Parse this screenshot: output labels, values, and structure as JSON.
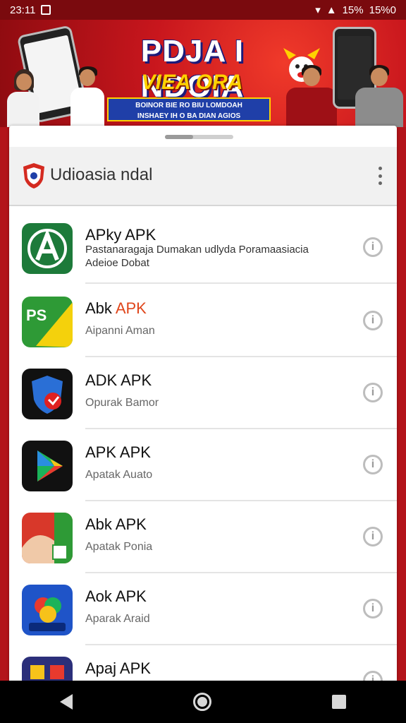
{
  "status_bar": {
    "time": "23:11",
    "battery_text": "15%",
    "extra_text": "15%0"
  },
  "banner": {
    "title": "PDJA I NDOIA",
    "subtitle": "VIEA ORA PAISIA",
    "tagline_line1": "BOINOR BIE RO BIU LOMDOAH",
    "tagline_line2": "INSHAEY IH O BA DIAN AGIOS"
  },
  "app_header": {
    "title": "Udioasia ndal"
  },
  "apps": [
    {
      "title": "APky APK",
      "title_accent": "",
      "subtitle": "Pastanaragaja Dumakan udlyda Poramaasiacia Adeioe Dobat",
      "icon": "a-logo-icon"
    },
    {
      "title": "Abk ",
      "title_accent": "APK",
      "subtitle": "Aipanni Aman",
      "icon": "ps-leaf-icon"
    },
    {
      "title": "ADK APK",
      "title_accent": "",
      "subtitle": "Opurak Bamor",
      "icon": "shield-icon"
    },
    {
      "title": "APK APK",
      "title_accent": "",
      "subtitle": "Apatak Auato",
      "icon": "play-icon"
    },
    {
      "title": "Abk APK",
      "title_accent": "",
      "subtitle": "Apatak Ponia",
      "icon": "photo-icon"
    },
    {
      "title": "Aok APK",
      "title_accent": "",
      "subtitle": "Aparak Araid",
      "icon": "swirl-icon"
    },
    {
      "title": "Apaj APK",
      "title_accent": "",
      "subtitle": "",
      "icon": "grid-icon"
    }
  ],
  "info_glyph": "i",
  "colors": {
    "brand_red": "#c8161d",
    "accent_orange": "#e0461b"
  }
}
